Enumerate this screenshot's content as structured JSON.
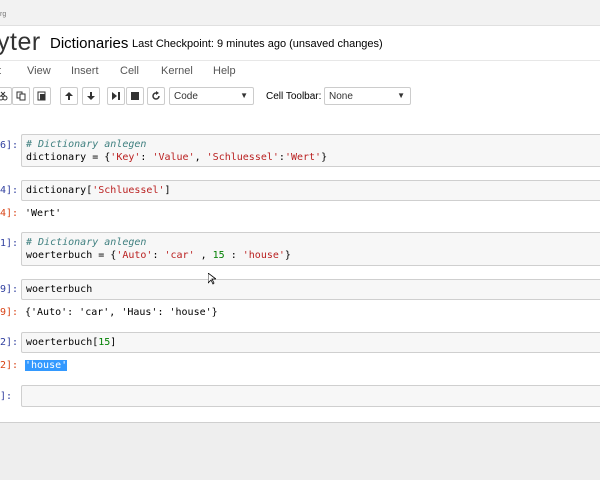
{
  "browser": {
    "url_fragment": "rg"
  },
  "header": {
    "logo_text": "yter",
    "notebook_title": "Dictionaries",
    "checkpoint": "Last Checkpoint: 9 minutes ago (unsaved changes)"
  },
  "menu": {
    "items": [
      "t",
      "View",
      "Insert",
      "Cell",
      "Kernel",
      "Help"
    ]
  },
  "toolbar": {
    "cell_type": "Code",
    "cell_toolbar_label": "Cell Toolbar:",
    "cell_toolbar_value": "None"
  },
  "cells": [
    {
      "prompt": "6]:",
      "lines": [
        [
          {
            "t": "# Dictionary anlegen",
            "c": "comment"
          }
        ],
        [
          {
            "t": "dictionary = {"
          },
          {
            "t": "'Key'",
            "c": "str"
          },
          {
            "t": ": "
          },
          {
            "t": "'Value'",
            "c": "str"
          },
          {
            "t": ", "
          },
          {
            "t": "'Schluessel'",
            "c": "str"
          },
          {
            "t": ":"
          },
          {
            "t": "'Wert'",
            "c": "str"
          },
          {
            "t": "}"
          }
        ]
      ]
    },
    {
      "prompt": "4]:",
      "lines": [
        [
          {
            "t": "dictionary["
          },
          {
            "t": "'Schluessel'",
            "c": "str"
          },
          {
            "t": "]"
          }
        ]
      ],
      "out_prompt": "4]:",
      "output": "'Wert'"
    },
    {
      "prompt": "1]:",
      "lines": [
        [
          {
            "t": "# Dictionary anlegen",
            "c": "comment"
          }
        ],
        [
          {
            "t": "woerterbuch = {"
          },
          {
            "t": "'Auto'",
            "c": "str"
          },
          {
            "t": ": "
          },
          {
            "t": "'car'",
            "c": "str"
          },
          {
            "t": " , "
          },
          {
            "t": "15",
            "c": "num"
          },
          {
            "t": " : "
          },
          {
            "t": "'house'",
            "c": "str"
          },
          {
            "t": "}"
          }
        ]
      ]
    },
    {
      "prompt": "9]:",
      "lines": [
        [
          {
            "t": "woerterbuch"
          }
        ]
      ],
      "out_prompt": "9]:",
      "output": "{'Auto': 'car', 'Haus': 'house'}"
    },
    {
      "prompt": "2]:",
      "lines": [
        [
          {
            "t": "woerterbuch["
          },
          {
            "t": "15",
            "c": "num"
          },
          {
            "t": "]"
          }
        ]
      ],
      "out_prompt": "2]:",
      "output": "'house'",
      "output_selected": true
    },
    {
      "prompt": " ]:",
      "lines": [
        [
          {
            "t": ""
          }
        ]
      ]
    }
  ]
}
